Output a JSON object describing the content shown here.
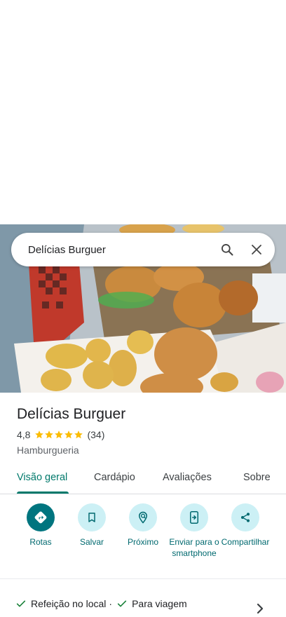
{
  "search": {
    "query": "Delícias Burguer"
  },
  "place": {
    "name": "Delícias Burguer",
    "rating": "4,8",
    "stars": 5,
    "review_count": "(34)",
    "category": "Hamburgueria"
  },
  "tabs": [
    {
      "label": "Visão geral",
      "active": true
    },
    {
      "label": "Cardápio"
    },
    {
      "label": "Avaliações"
    },
    {
      "label": "Sobre"
    }
  ],
  "actions": [
    {
      "label": "Rotas",
      "icon": "directions-icon"
    },
    {
      "label": "Salvar",
      "icon": "bookmark-icon"
    },
    {
      "label": "Próximo",
      "icon": "nearby-icon"
    },
    {
      "label": "Enviar para o smartphone",
      "icon": "send-to-phone-icon"
    },
    {
      "label": "Compartilhar",
      "icon": "share-icon"
    }
  ],
  "features": [
    {
      "label": "Refeição no local"
    },
    {
      "label": "Para viagem"
    }
  ],
  "colors": {
    "accent": "#00796b",
    "action_bg": "#ccf0f5",
    "primary_action": "#00757f",
    "star": "#fbbc04"
  }
}
